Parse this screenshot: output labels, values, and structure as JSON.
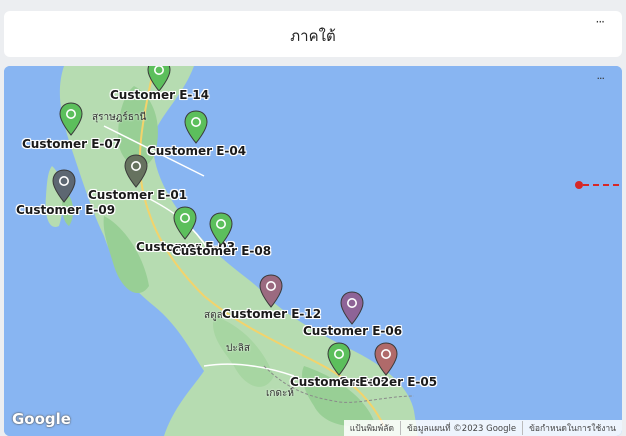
{
  "header": {
    "title": "ภาคใต้",
    "more_label": "···"
  },
  "map": {
    "more_label": "···",
    "logo": "Google",
    "attribution": [
      "แป้นพิมพ์ลัด",
      "ข้อมูลแผนที่ ©2023 Google",
      "ข้อกำหนดในการใช้งาน"
    ],
    "places": [
      "สุราษฎร์ธานี",
      "สตูล",
      "ปะลิส",
      "เกดะห์"
    ],
    "markers": [
      {
        "label": "Customer E-14",
        "color": "#5cbf5c"
      },
      {
        "label": "Customer E-07",
        "color": "#5cbf5c"
      },
      {
        "label": "Customer E-04",
        "color": "#5cbf5c"
      },
      {
        "label": "Customer E-01",
        "color": "#66725f"
      },
      {
        "label": "Customer E-09",
        "color": "#5d6772"
      },
      {
        "label": "Customer E-03",
        "color": "#5cbf5c"
      },
      {
        "label": "Customer E-08",
        "color": "#5cbf5c"
      },
      {
        "label": "Customer E-12",
        "color": "#9b6a80"
      },
      {
        "label": "Customer E-06",
        "color": "#8e6497"
      },
      {
        "label": "Customer E-05",
        "color": "#b06a6a"
      },
      {
        "label": "Customer E-02",
        "color": "#5cbf5c"
      }
    ]
  }
}
